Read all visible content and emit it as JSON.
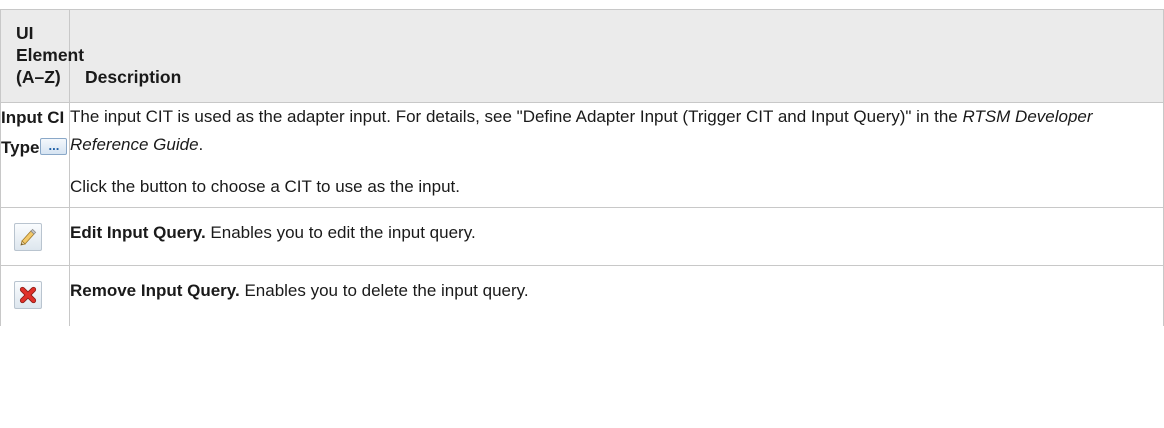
{
  "table": {
    "header": {
      "col1": "UI Element (A–Z)",
      "col1_lines": [
        "UI",
        "Element",
        "(A–Z)"
      ],
      "col2": "Description"
    },
    "rows": [
      {
        "element_lines": [
          "Input CI",
          "Type"
        ],
        "icon": "ellipsis-browse-icon",
        "desc_p1_a": "The input CIT is used as the adapter input. For details, see \"Define Adapter Input (Trigger CIT and Input Query)\" in the ",
        "desc_p1_em": "RTSM Developer Reference Guide",
        "desc_p1_b": ".",
        "desc_p2": "Click the button to choose a CIT to use as the input."
      },
      {
        "icon": "pencil-edit-icon",
        "lead": "Edit Input Query.",
        "desc": " Enables you to edit the input query."
      },
      {
        "icon": "red-x-remove-icon",
        "lead": "Remove Input Query.",
        "desc": " Enables you to delete the input query."
      }
    ]
  },
  "colors": {
    "header_bg": "#ebebeb",
    "border": "#c8c8c8",
    "remove_icon": "#d9241c"
  }
}
